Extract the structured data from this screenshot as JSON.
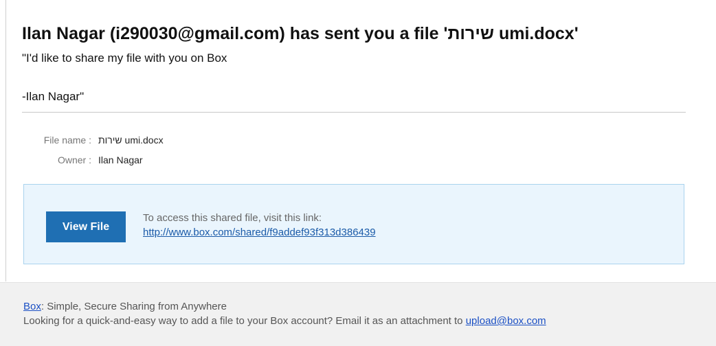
{
  "email": {
    "title": "Ilan Nagar (i290030@gmail.com) has sent you a file 'שירות umi.docx'",
    "message_line1": "\"I'd like to share my file with you on Box",
    "message_line2": "-Ilan Nagar\""
  },
  "file_info": {
    "name_label": "File name :",
    "name_value": "שירות umi.docx",
    "owner_label": "Owner :",
    "owner_value": "Ilan Nagar"
  },
  "share": {
    "button_label": "View File",
    "access_text": "To access this shared file, visit this link:",
    "link_text": "http://www.box.com/shared/f9addef93f313d386439"
  },
  "footer": {
    "box_link": "Box",
    "tagline": ": Simple, Secure Sharing from Anywhere",
    "upload_prompt": "Looking for a quick-and-easy way to add a file to your Box account? Email it as an attachment to ",
    "upload_email": "upload@box.com"
  },
  "colors": {
    "button_bg": "#1f6fb3",
    "share_box_bg": "#eaf5fd",
    "share_box_border": "#a9d3ee",
    "link": "#1a5aa8",
    "footer_bg": "#f1f1f1"
  }
}
